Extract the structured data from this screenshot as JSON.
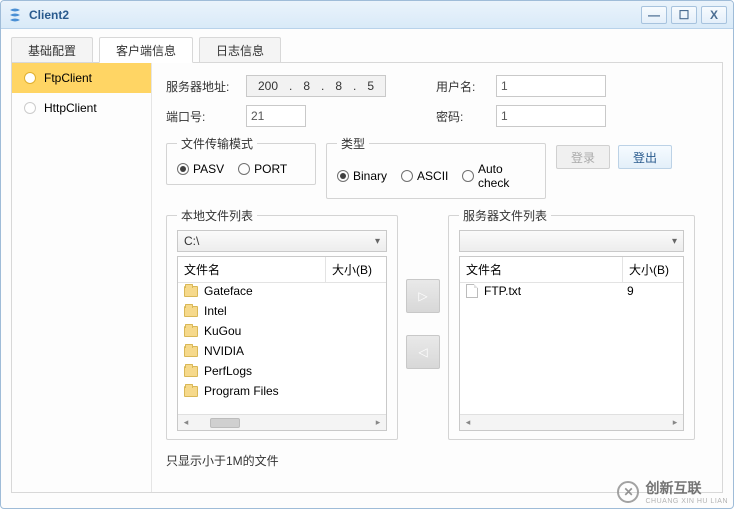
{
  "window": {
    "title": "Client2"
  },
  "tabs": {
    "t0": "基础配置",
    "t1": "客户端信息",
    "t2": "日志信息"
  },
  "sidebar": {
    "items": [
      "FtpClient",
      "HttpClient"
    ]
  },
  "conn": {
    "server_addr_label": "服务器地址:",
    "ip": {
      "a": "200",
      "b": "8",
      "c": "8",
      "d": "5"
    },
    "port_label": "端口号:",
    "port_value": "21",
    "user_label": "用户名:",
    "user_value": "1",
    "pass_label": "密码:",
    "pass_value": "1"
  },
  "transfer": {
    "legend": "文件传输模式",
    "opt_pasv": "PASV",
    "opt_port": "PORT"
  },
  "type": {
    "legend": "类型",
    "opt_bin": "Binary",
    "opt_ascii": "ASCII",
    "opt_auto": "Auto check"
  },
  "buttons": {
    "login": "登录",
    "logout": "登出"
  },
  "local": {
    "legend": "本地文件列表",
    "path": "C:\\",
    "col_name": "文件名",
    "col_size": "大小(B)",
    "rows": [
      "Gateface",
      "Intel",
      "KuGou",
      "NVIDIA",
      "PerfLogs",
      "Program Files"
    ]
  },
  "remote": {
    "legend": "服务器文件列表",
    "path": "",
    "col_name": "文件名",
    "col_size": "大小(B)",
    "rows": [
      {
        "name": "FTP.txt",
        "size": "9"
      }
    ]
  },
  "note": "只显示小于1M的文件",
  "watermark": {
    "brand": "创新互联",
    "sub": "CHUANG XIN HU LIAN"
  }
}
